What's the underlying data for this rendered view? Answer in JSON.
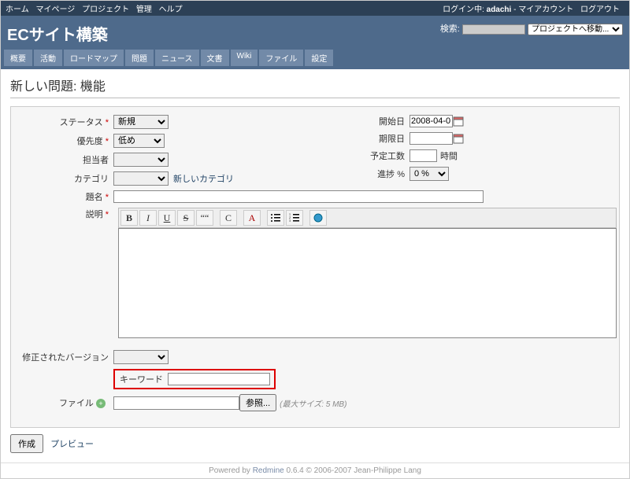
{
  "top_menu": {
    "left": [
      "ホーム",
      "マイページ",
      "プロジェクト",
      "管理",
      "ヘルプ"
    ],
    "login_prefix": "ログイン中:",
    "login_user": "adachi",
    "right": [
      "マイアカウント",
      "ログアウト"
    ]
  },
  "header": {
    "title": "ECサイト構築",
    "search_label": "検索:",
    "jump_placeholder": "プロジェクトへ移動..."
  },
  "main_menu": [
    "概要",
    "活動",
    "ロードマップ",
    "問題",
    "ニュース",
    "文書",
    "Wiki",
    "ファイル",
    "設定"
  ],
  "page": {
    "heading": "新しい問題: 機能"
  },
  "form": {
    "status_label": "ステータス",
    "status_value": "新規",
    "priority_label": "優先度",
    "priority_value": "低め",
    "assignee_label": "担当者",
    "category_label": "カテゴリ",
    "new_category": "新しいカテゴリ",
    "subject_label": "題名",
    "description_label": "説明",
    "start_label": "開始日",
    "start_value": "2008-04-0",
    "due_label": "期限日",
    "est_label": "予定工数",
    "est_suffix": "時間",
    "done_label": "進捗 %",
    "done_value": "0 %",
    "fixed_version_label": "修正されたバージョン",
    "keyword_label": "キーワード",
    "file_label": "ファイル",
    "browse_btn": "参照...",
    "file_hint": "(最大サイズ: 5 MB)"
  },
  "toolbar": {
    "b": "B",
    "i": "I",
    "u": "U",
    "s": "S",
    "q": "““",
    "c": "C",
    "a": "A"
  },
  "actions": {
    "submit": "作成",
    "preview": "プレビュー"
  },
  "footer": {
    "powered": "Powered by",
    "app": "Redmine",
    "rest": "0.6.4 © 2006-2007 Jean-Philippe Lang"
  }
}
